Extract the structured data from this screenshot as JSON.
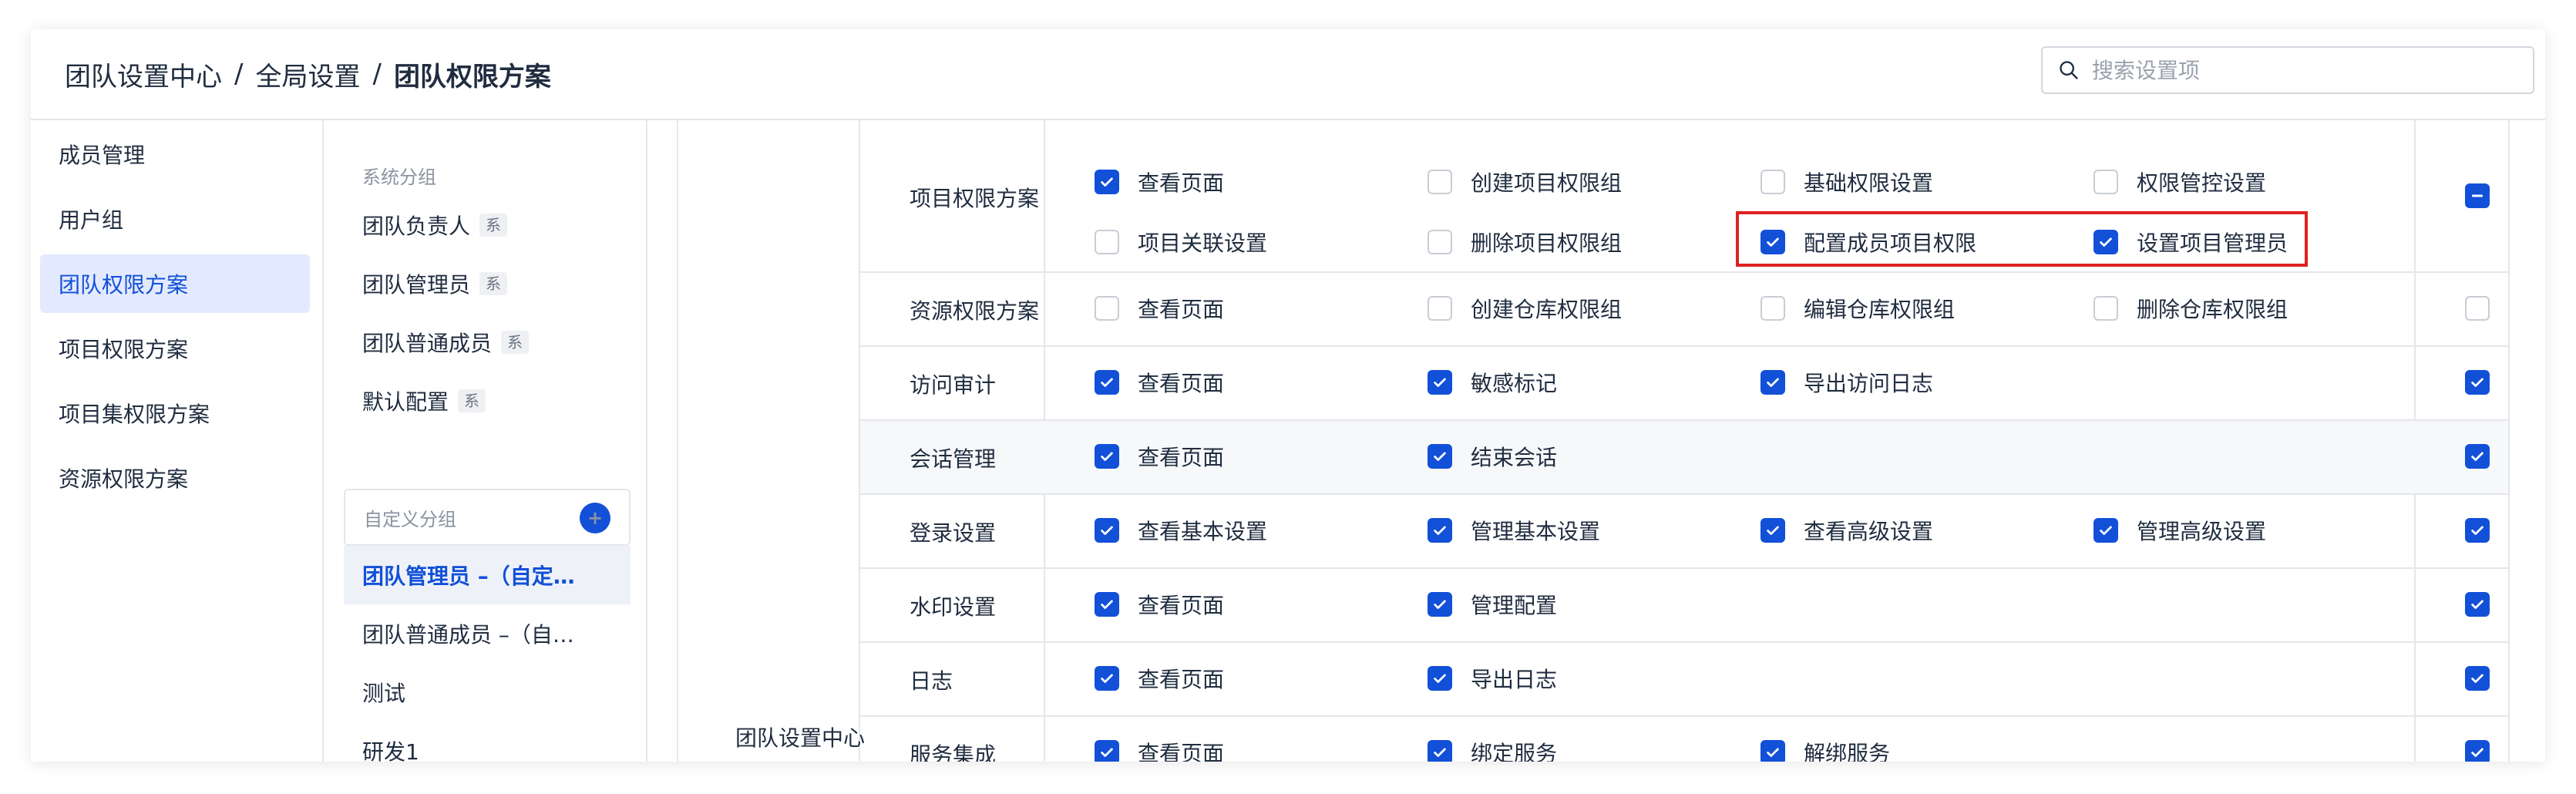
{
  "breadcrumb": {
    "items": [
      "团队设置中心",
      "全局设置",
      "团队权限方案"
    ],
    "separator": "/"
  },
  "search": {
    "placeholder": "搜索设置项"
  },
  "nav": {
    "items": [
      "成员管理",
      "用户组",
      "团队权限方案",
      "项目权限方案",
      "项目集权限方案",
      "资源权限方案"
    ],
    "active_index": 2
  },
  "groups": {
    "system_label": "系统分组",
    "system_badge": "系",
    "system_items": [
      "团队负责人",
      "团队管理员",
      "团队普通成员",
      "默认配置"
    ],
    "custom_label": "自定义分组",
    "custom_items": [
      "团队管理员 –（自定…",
      "团队普通成员 –（自…",
      "测试",
      "研发1"
    ],
    "custom_active_index": 0
  },
  "table": {
    "section": "团队设置中心",
    "rows": [
      {
        "module": "项目权限方案",
        "all": "partial",
        "perms": [
          {
            "label": "查看页面",
            "checked": true
          },
          {
            "label": "创建项目权限组",
            "checked": false
          },
          {
            "label": "基础权限设置",
            "checked": false
          },
          {
            "label": "权限管控设置",
            "checked": false
          },
          {
            "label": "项目关联设置",
            "checked": false
          },
          {
            "label": "删除项目权限组",
            "checked": false
          },
          {
            "label": "配置成员项目权限",
            "checked": true
          },
          {
            "label": "设置项目管理员",
            "checked": true
          }
        ]
      },
      {
        "module": "资源权限方案",
        "all": "unchecked",
        "perms": [
          {
            "label": "查看页面",
            "checked": false
          },
          {
            "label": "创建仓库权限组",
            "checked": false
          },
          {
            "label": "编辑仓库权限组",
            "checked": false
          },
          {
            "label": "删除仓库权限组",
            "checked": false
          }
        ]
      },
      {
        "module": "访问审计",
        "all": "checked",
        "perms": [
          {
            "label": "查看页面",
            "checked": true
          },
          {
            "label": "敏感标记",
            "checked": true
          },
          {
            "label": "导出访问日志",
            "checked": true
          }
        ]
      },
      {
        "module": "会话管理",
        "all": "checked",
        "perms": [
          {
            "label": "查看页面",
            "checked": true
          },
          {
            "label": "结束会话",
            "checked": true
          }
        ]
      },
      {
        "module": "登录设置",
        "all": "checked",
        "perms": [
          {
            "label": "查看基本设置",
            "checked": true
          },
          {
            "label": "管理基本设置",
            "checked": true
          },
          {
            "label": "查看高级设置",
            "checked": true
          },
          {
            "label": "管理高级设置",
            "checked": true
          }
        ]
      },
      {
        "module": "水印设置",
        "all": "checked",
        "perms": [
          {
            "label": "查看页面",
            "checked": true
          },
          {
            "label": "管理配置",
            "checked": true
          }
        ]
      },
      {
        "module": "日志",
        "all": "checked",
        "perms": [
          {
            "label": "查看页面",
            "checked": true
          },
          {
            "label": "导出日志",
            "checked": true
          }
        ]
      },
      {
        "module": "服务集成",
        "all": "checked",
        "perms": [
          {
            "label": "查看页面",
            "checked": true
          },
          {
            "label": "绑定服务",
            "checked": true
          },
          {
            "label": "解绑服务",
            "checked": true
          }
        ]
      }
    ]
  },
  "colors": {
    "accent": "#1250d8",
    "highlight": "#e02020",
    "active_nav_bg": "#e3eaff"
  },
  "icons": {
    "search": "search-icon",
    "add": "plus-icon",
    "checkbox": "checkbox-icon"
  }
}
